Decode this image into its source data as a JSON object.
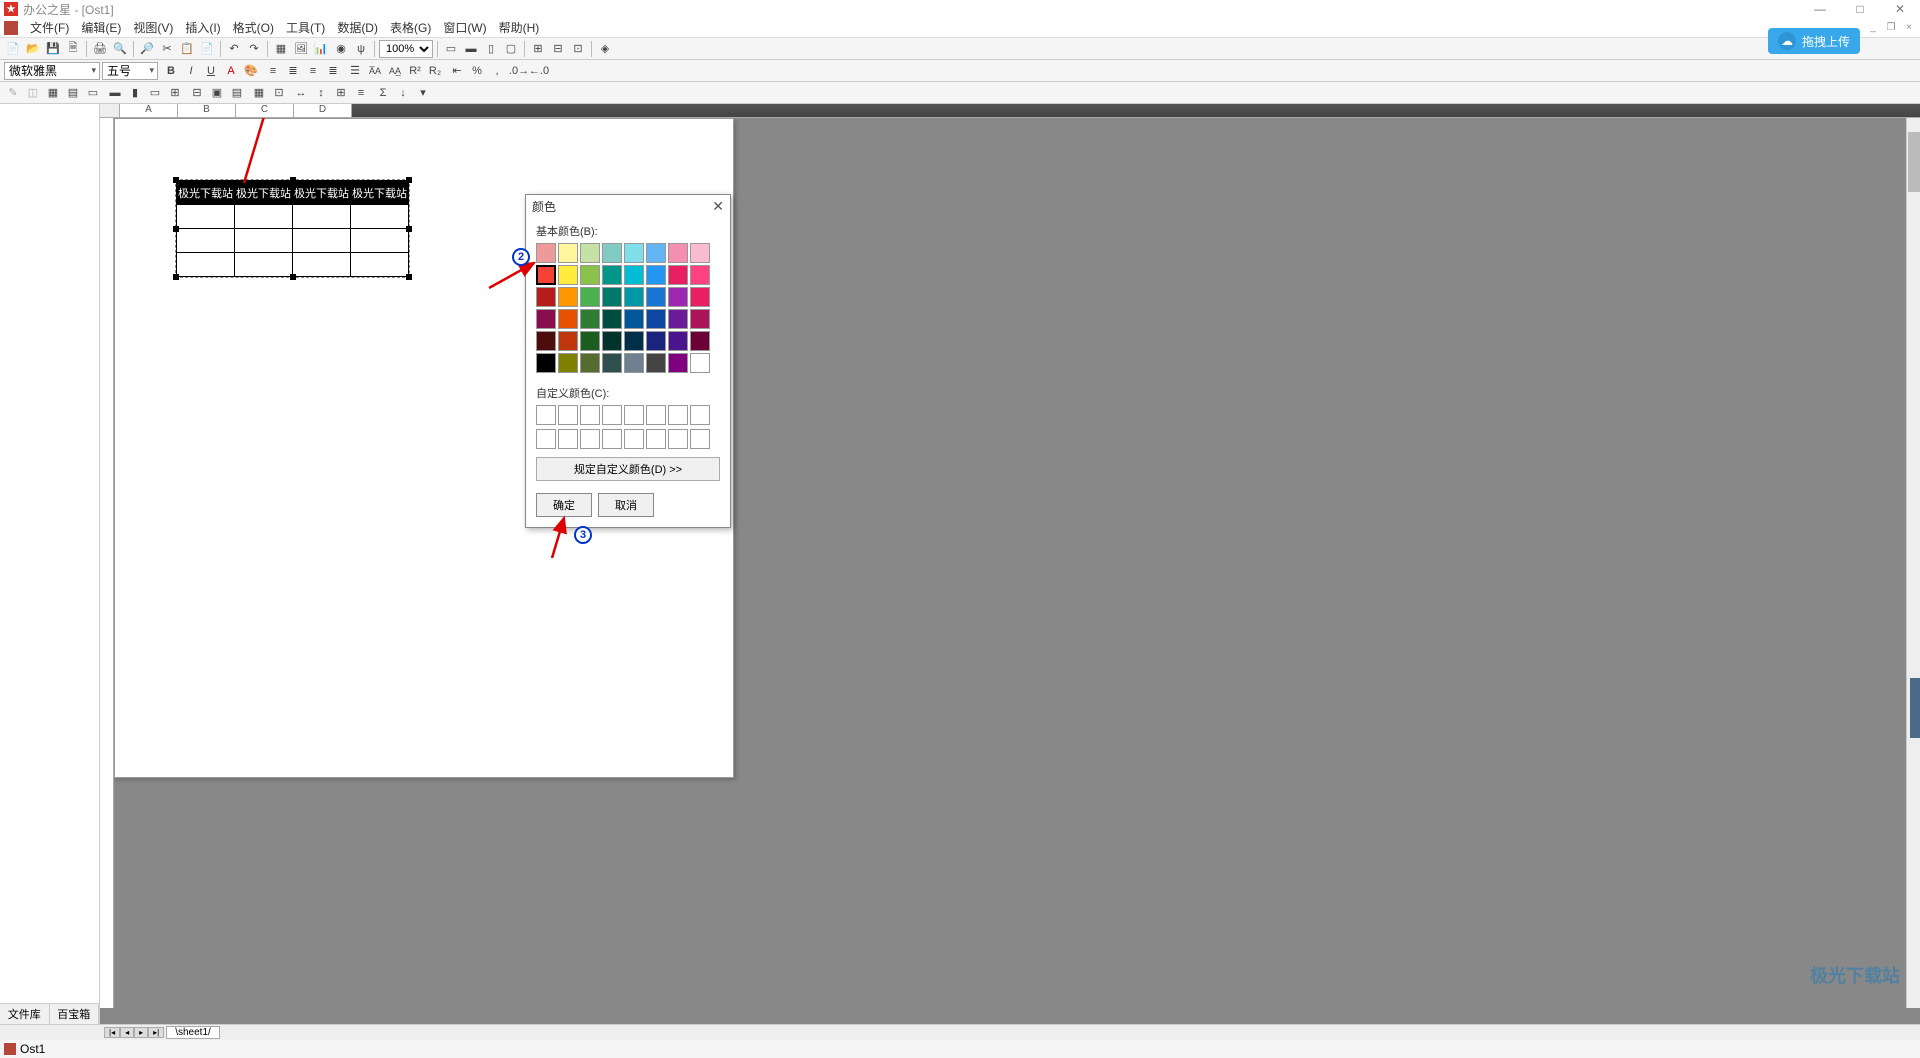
{
  "app": {
    "title": "办公之星 - [Ost1]"
  },
  "menu": {
    "file": "文件(F)",
    "edit": "编辑(E)",
    "view": "视图(V)",
    "insert": "插入(I)",
    "format": "格式(O)",
    "tools": "工具(T)",
    "data": "数据(D)",
    "table": "表格(G)",
    "window": "窗口(W)",
    "help": "帮助(H)"
  },
  "cloud_button": "拖拽上传",
  "toolbar": {
    "zoom": "100%"
  },
  "format_bar": {
    "font": "微软雅黑",
    "size": "五号"
  },
  "left_tabs": {
    "lib": "文件库",
    "box": "百宝箱"
  },
  "columns": [
    "A",
    "B",
    "C",
    "D"
  ],
  "table_header": "极光下载站",
  "color_dialog": {
    "title": "颜色",
    "basic_label": "基本颜色(B):",
    "custom_label": "自定义颜色(C):",
    "define": "规定自定义颜色(D) >>",
    "ok": "确定",
    "cancel": "取消",
    "basic_colors": [
      "#ef9a9a",
      "#fff59d",
      "#c5e1a5",
      "#80cbc4",
      "#80deea",
      "#64b5f6",
      "#f48fb1",
      "#f8bbd0",
      "#f44336",
      "#ffeb3b",
      "#8bc34a",
      "#009688",
      "#00bcd4",
      "#2196f3",
      "#e91e63",
      "#ff4081",
      "#b71c1c",
      "#ff9800",
      "#4caf50",
      "#00796b",
      "#0097a7",
      "#1976d2",
      "#9c27b0",
      "#e91e63",
      "#880e4f",
      "#e65100",
      "#2e7d32",
      "#004d40",
      "#01579b",
      "#0d47a1",
      "#6a1b9a",
      "#ad1457",
      "#4e0d0d",
      "#bf360c",
      "#1b5e20",
      "#00332b",
      "#003049",
      "#1a237e",
      "#4a148c",
      "#6a0036",
      "#000000",
      "#808000",
      "#556b2f",
      "#2f4f4f",
      "#708090",
      "#444444",
      "#800080",
      "#ffffff"
    ]
  },
  "sheet_tab": "sheet1",
  "doc_tab": "Ost1",
  "watermark": "极光下载站"
}
